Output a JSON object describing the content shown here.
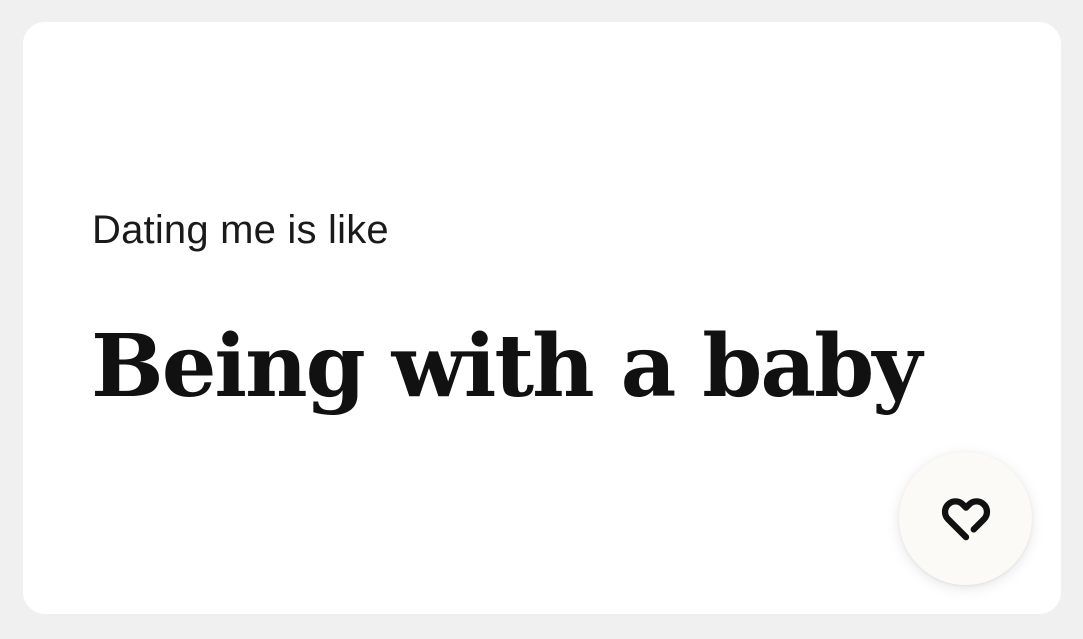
{
  "card": {
    "prompt": "Dating me is like",
    "answer": "Being with a baby"
  },
  "like_button": {
    "icon": "heart-icon",
    "icon_color": "#111111",
    "background": "#fbfaf7"
  }
}
